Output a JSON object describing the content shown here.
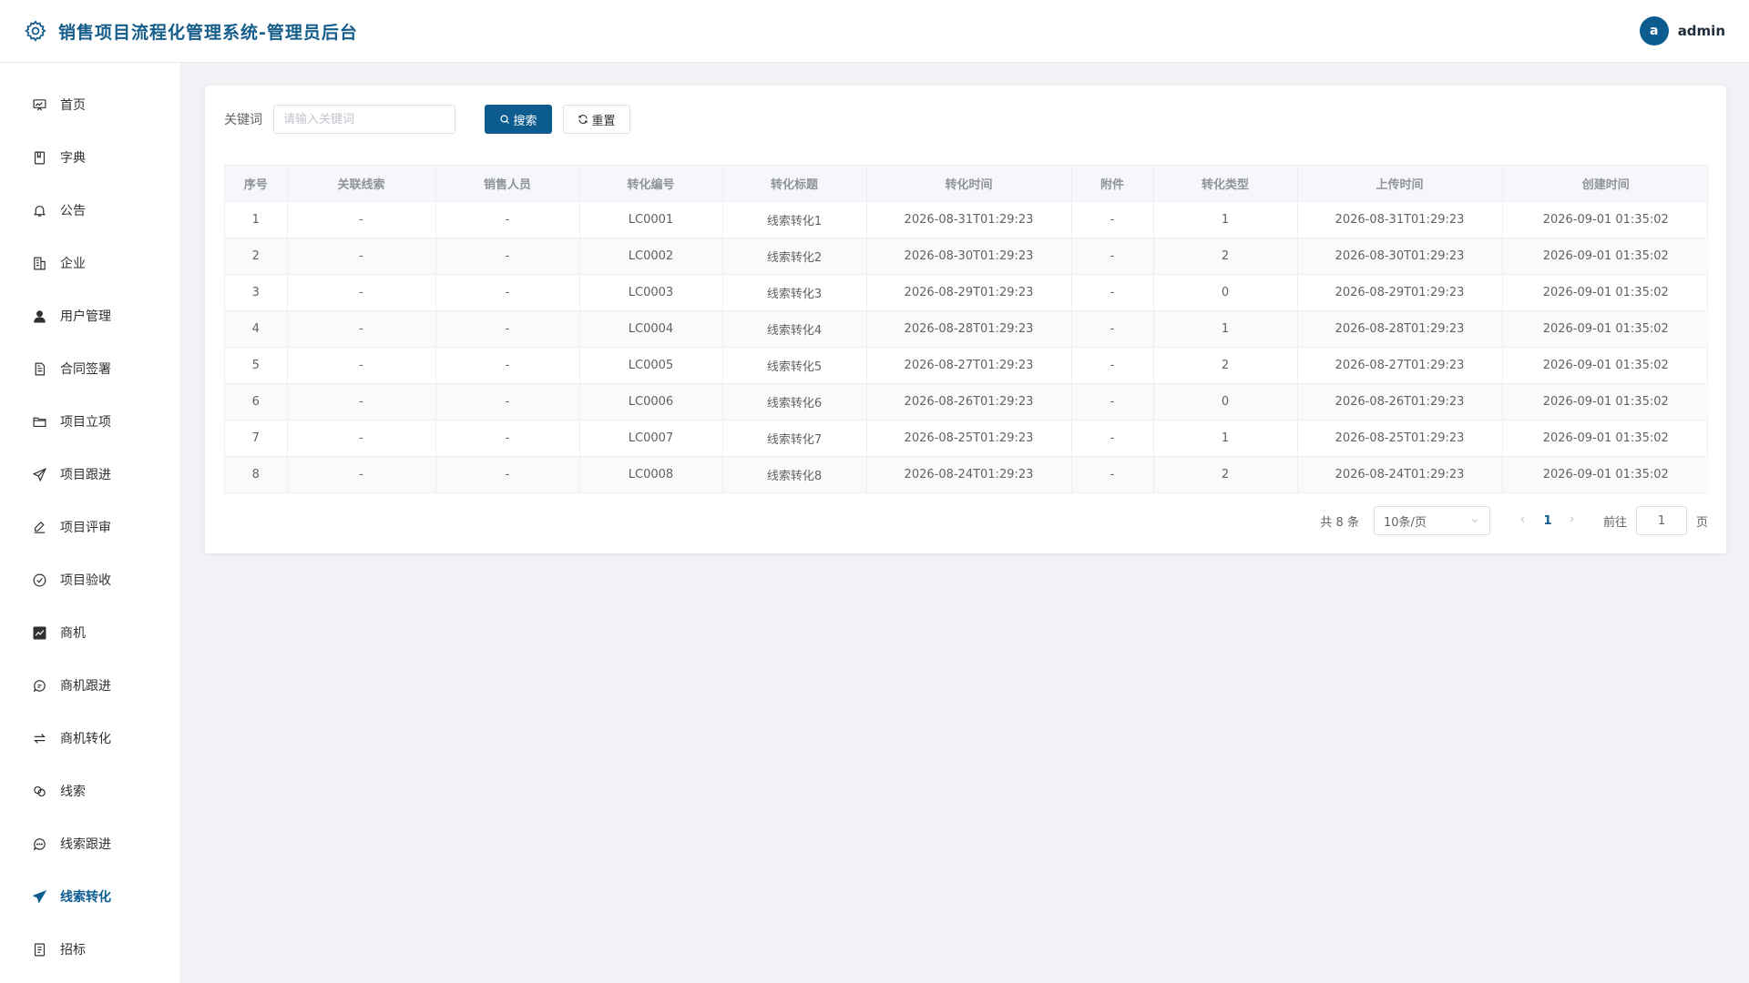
{
  "header": {
    "title": "销售项目流程化管理系统-管理员后台",
    "avatar_letter": "a",
    "username": "admin"
  },
  "sidebar": {
    "items": [
      {
        "label": "首页",
        "icon": "dashboard-icon"
      },
      {
        "label": "字典",
        "icon": "book-icon"
      },
      {
        "label": "公告",
        "icon": "bell-icon"
      },
      {
        "label": "企业",
        "icon": "building-icon"
      },
      {
        "label": "用户管理",
        "icon": "user-icon"
      },
      {
        "label": "合同签署",
        "icon": "document-icon"
      },
      {
        "label": "项目立项",
        "icon": "folder-icon"
      },
      {
        "label": "项目跟进",
        "icon": "send-icon"
      },
      {
        "label": "项目评审",
        "icon": "edit-icon"
      },
      {
        "label": "项目验收",
        "icon": "check-circle-icon"
      },
      {
        "label": "商机",
        "icon": "chart-icon"
      },
      {
        "label": "商机跟进",
        "icon": "chat-icon"
      },
      {
        "label": "商机转化",
        "icon": "switch-icon"
      },
      {
        "label": "线索",
        "icon": "link-icon"
      },
      {
        "label": "线索跟进",
        "icon": "chat-dots-icon"
      },
      {
        "label": "线索转化",
        "icon": "paper-plane-icon"
      },
      {
        "label": "招标",
        "icon": "tickets-icon"
      }
    ],
    "active_index": 15
  },
  "search": {
    "label": "关键词",
    "placeholder": "请输入关键词",
    "value": "",
    "search_btn": "搜索",
    "reset_btn": "重置"
  },
  "table": {
    "columns": [
      "序号",
      "关联线索",
      "销售人员",
      "转化编号",
      "转化标题",
      "转化时间",
      "附件",
      "转化类型",
      "上传时间",
      "创建时间"
    ],
    "rows": [
      [
        "1",
        "-",
        "-",
        "LC0001",
        "线索转化1",
        "2026-08-31T01:29:23",
        "-",
        "1",
        "2026-08-31T01:29:23",
        "2026-09-01 01:35:02"
      ],
      [
        "2",
        "-",
        "-",
        "LC0002",
        "线索转化2",
        "2026-08-30T01:29:23",
        "-",
        "2",
        "2026-08-30T01:29:23",
        "2026-09-01 01:35:02"
      ],
      [
        "3",
        "-",
        "-",
        "LC0003",
        "线索转化3",
        "2026-08-29T01:29:23",
        "-",
        "0",
        "2026-08-29T01:29:23",
        "2026-09-01 01:35:02"
      ],
      [
        "4",
        "-",
        "-",
        "LC0004",
        "线索转化4",
        "2026-08-28T01:29:23",
        "-",
        "1",
        "2026-08-28T01:29:23",
        "2026-09-01 01:35:02"
      ],
      [
        "5",
        "-",
        "-",
        "LC0005",
        "线索转化5",
        "2026-08-27T01:29:23",
        "-",
        "2",
        "2026-08-27T01:29:23",
        "2026-09-01 01:35:02"
      ],
      [
        "6",
        "-",
        "-",
        "LC0006",
        "线索转化6",
        "2026-08-26T01:29:23",
        "-",
        "0",
        "2026-08-26T01:29:23",
        "2026-09-01 01:35:02"
      ],
      [
        "7",
        "-",
        "-",
        "LC0007",
        "线索转化7",
        "2026-08-25T01:29:23",
        "-",
        "1",
        "2026-08-25T01:29:23",
        "2026-09-01 01:35:02"
      ],
      [
        "8",
        "-",
        "-",
        "LC0008",
        "线索转化8",
        "2026-08-24T01:29:23",
        "-",
        "2",
        "2026-08-24T01:29:23",
        "2026-09-01 01:35:02"
      ]
    ]
  },
  "pagination": {
    "total_text": "共 8 条",
    "page_size": "10条/页",
    "current_page": "1",
    "goto_label": "前往",
    "goto_value": "1",
    "page_suffix": "页"
  },
  "colors": {
    "primary": "#0d5c8f",
    "header_title": "#155d8a"
  }
}
